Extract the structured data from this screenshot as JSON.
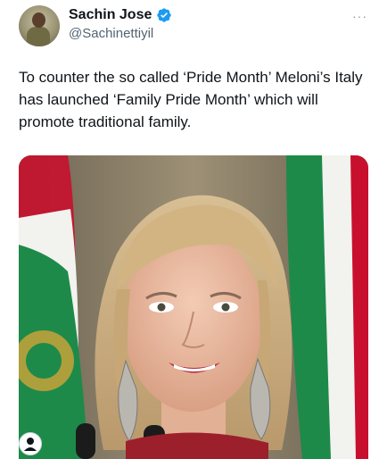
{
  "tweet": {
    "author_name": "Sachin Jose",
    "author_handle": "@Sachinettiyil",
    "more_label": "···",
    "text": "To counter the so called ‘Pride Month’ Meloni’s Italy has launched ‘Family Pride Month’ which will promote traditional family."
  },
  "colors": {
    "verified_badge": "#1d9bf0",
    "text_primary": "#0f1419",
    "text_secondary": "#536471",
    "flag_green": "#1d8a4a",
    "flag_white": "#f2f2ee",
    "flag_red": "#c8102e"
  },
  "icons": {
    "verified": "verified-badge-icon",
    "more": "more-options-icon",
    "media_tag": "person-tag-icon"
  }
}
